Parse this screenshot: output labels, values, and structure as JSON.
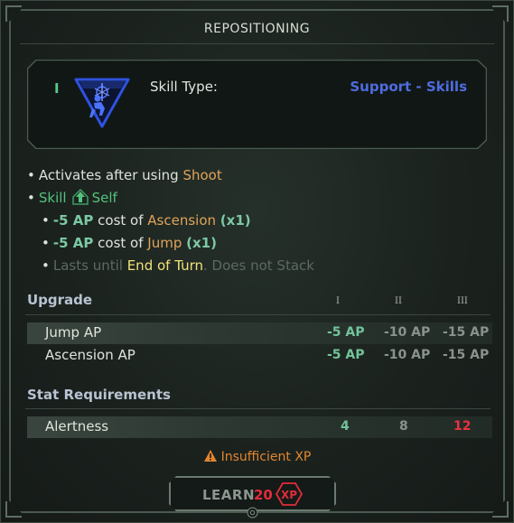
{
  "title": "REPOSITIONING",
  "skill": {
    "tier": "I",
    "icon": "repositioning-skill-icon",
    "type_label": "Skill Type:",
    "type_value": "Support - Skills",
    "type_color": "#4e6ce0"
  },
  "description": {
    "line1": {
      "prefix": "Activates after using",
      "action": "Shoot"
    },
    "line2": {
      "kind": "Skill",
      "target_icon": "up-arrow-icon",
      "target": "Self"
    },
    "effects": [
      {
        "amount": "-5 AP",
        "text": "cost of",
        "skill": "Ascension",
        "mult": "(x1)"
      },
      {
        "amount": "-5 AP",
        "text": "cost of",
        "skill": "Jump",
        "mult": "(x1)"
      }
    ],
    "duration": {
      "prefix": "Lasts until",
      "until": "End of Turn",
      "suffix": ". Does not Stack"
    }
  },
  "upgrade": {
    "heading": "Upgrade",
    "tiers": [
      "I",
      "II",
      "III"
    ],
    "rows": [
      {
        "label": "Jump AP",
        "values": [
          "-5 AP",
          "-10 AP",
          "-15 AP"
        ]
      },
      {
        "label": "Ascension AP",
        "values": [
          "-5 AP",
          "-10 AP",
          "-15 AP"
        ]
      }
    ]
  },
  "requirements": {
    "heading": "Stat Requirements",
    "rows": [
      {
        "label": "Alertness",
        "values": [
          "4",
          "8",
          "12"
        ]
      }
    ]
  },
  "warning": {
    "icon": "warning-icon",
    "text": "Insufficient XP"
  },
  "learn": {
    "label": "LEARN",
    "cost": "20",
    "currency": "XP"
  },
  "colors": {
    "accent_green": "#55c27e",
    "highlight_orange": "#e0a458",
    "error_red": "#e02c3a",
    "warning_orange": "#e2852f"
  }
}
